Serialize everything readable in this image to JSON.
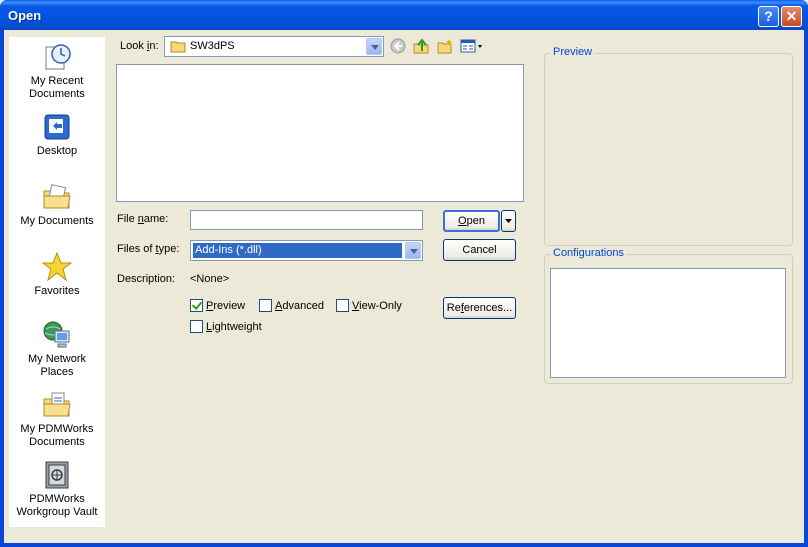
{
  "window": {
    "title": "Open"
  },
  "title_buttons": {
    "help": "?",
    "close": "✕"
  },
  "places": [
    {
      "label_line1": "My Recent",
      "label_line2": "Documents",
      "icon": "recent-documents-icon"
    },
    {
      "label_line1": "Desktop",
      "label_line2": "",
      "icon": "desktop-icon"
    },
    {
      "label_line1": "My Documents",
      "label_line2": "",
      "icon": "my-documents-icon"
    },
    {
      "label_line1": "Favorites",
      "label_line2": "",
      "icon": "favorites-star-icon"
    },
    {
      "label_line1": "My Network",
      "label_line2": "Places",
      "icon": "network-places-icon"
    },
    {
      "label_line1": "My PDMWorks",
      "label_line2": "Documents",
      "icon": "pdmworks-documents-icon"
    },
    {
      "label_line1": "PDMWorks",
      "label_line2": "Workgroup Vault",
      "icon": "pdmworks-vault-icon"
    }
  ],
  "look_in": {
    "label_pre": "Look ",
    "label_ul": "i",
    "label_post": "n:",
    "value": "SW3dPS"
  },
  "file_name": {
    "label_pre": "File ",
    "label_ul": "n",
    "label_post": "ame:",
    "value": ""
  },
  "files_of_type": {
    "label_pre": "Files of ",
    "label_ul": "t",
    "label_post": "ype:",
    "value": "Add-Ins (*.dll)"
  },
  "description": {
    "label": "Description:",
    "value": "<None>"
  },
  "buttons": {
    "open_ul": "O",
    "open_rest": "pen",
    "cancel": "Cancel",
    "references_pre": "Re",
    "references_ul": "f",
    "references_post": "erences..."
  },
  "options": {
    "preview": {
      "ul": "P",
      "rest": "review",
      "checked": true
    },
    "advanced": {
      "ul": "A",
      "rest": "dvanced",
      "checked": false
    },
    "view_only": {
      "ul": "V",
      "rest": "iew-Only",
      "checked": false
    },
    "lightweight": {
      "ul": "L",
      "rest": "ightweight",
      "checked": false
    }
  },
  "panels": {
    "preview_title": "Preview",
    "configurations_title": "Configurations"
  },
  "colors": {
    "titlebar": "#0054e3",
    "selection": "#316ac5",
    "group_title": "#0046d5"
  }
}
